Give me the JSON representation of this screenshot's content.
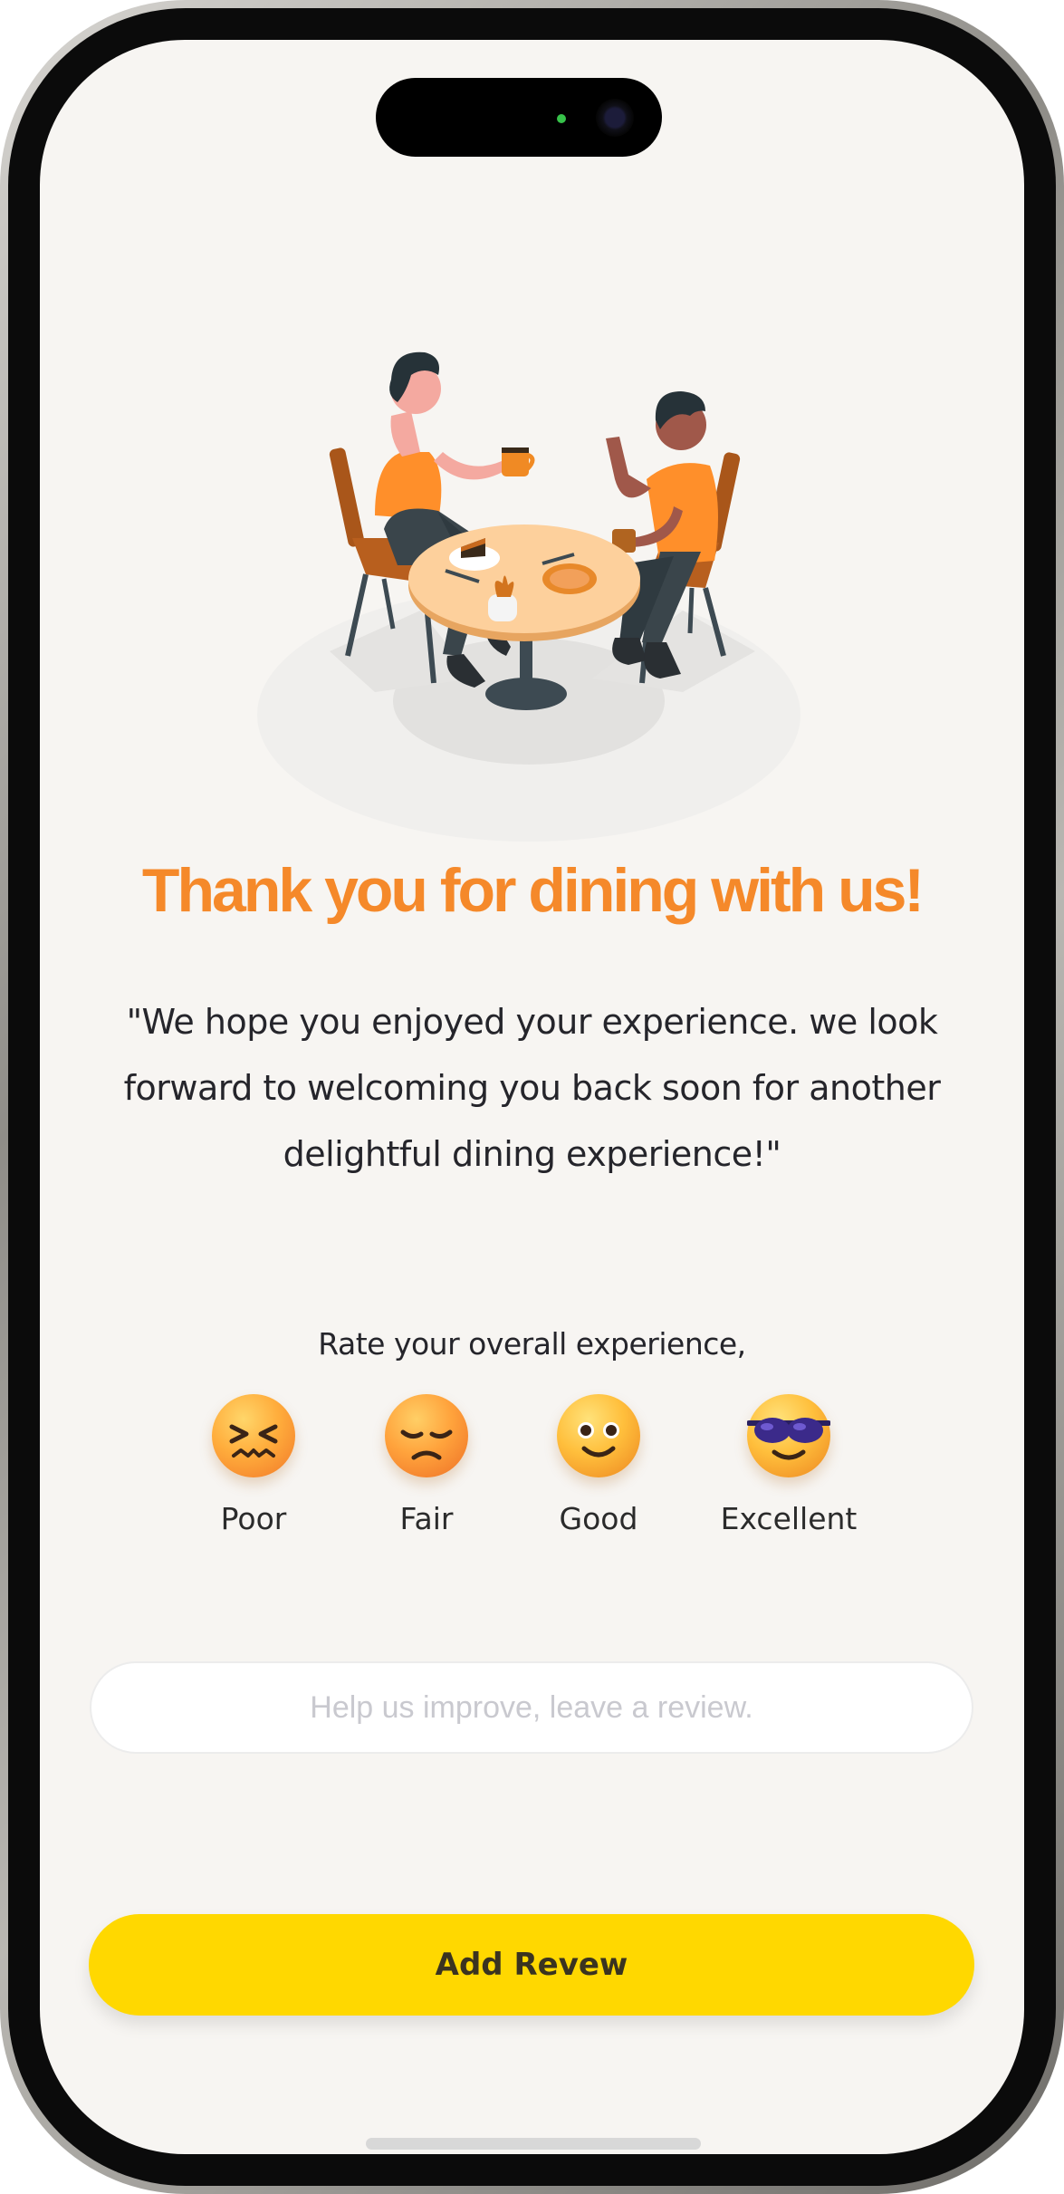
{
  "header": {
    "title": "Thank you for dining with us!",
    "message": "\"We hope you enjoyed your experience. we look forward to welcoming you back soon for another delightful dining experience!\""
  },
  "rating": {
    "prompt": "Rate your overall experience,",
    "options": [
      {
        "label": "Poor",
        "icon": "confounded-face-icon"
      },
      {
        "label": "Fair",
        "icon": "pensive-face-icon"
      },
      {
        "label": "Good",
        "icon": "smiling-face-icon"
      },
      {
        "label": "Excellent",
        "icon": "sunglasses-face-icon"
      }
    ]
  },
  "review": {
    "placeholder": "Help us improve, leave a review.",
    "value": ""
  },
  "submit": {
    "label": "Add Revew"
  },
  "colors": {
    "accent": "#f5892a",
    "button": "#ffd800",
    "background": "#f7f5f2"
  }
}
